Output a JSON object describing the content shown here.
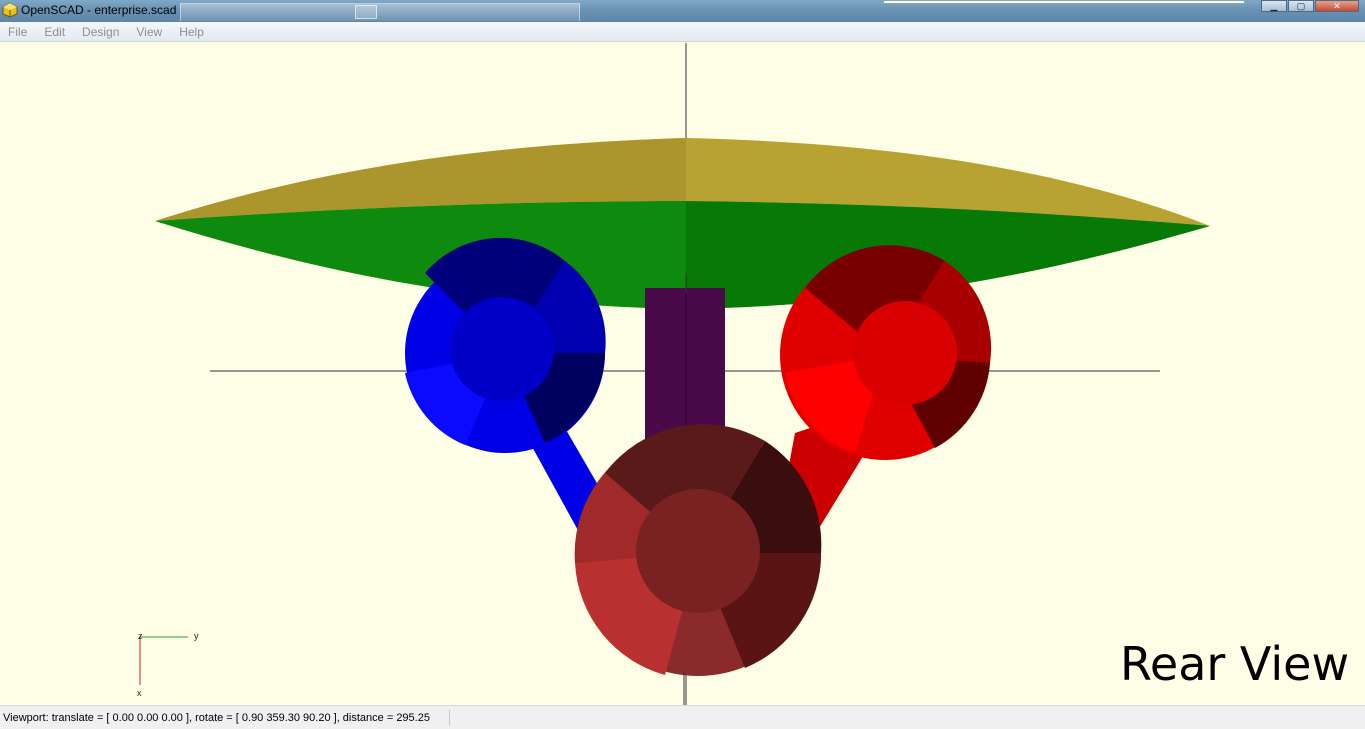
{
  "window": {
    "title": "OpenSCAD - enterprise.scad",
    "min_symbol": "▁",
    "max_symbol": "▢",
    "close_symbol": "✕"
  },
  "menu": {
    "file": "File",
    "edit": "Edit",
    "design": "Design",
    "view": "View",
    "help": "Help"
  },
  "viewport": {
    "overlay_label": "Rear View",
    "axis_z": "z",
    "axis_y": "y",
    "axis_x": "x",
    "background_color": "#fefee6",
    "saucer_top_color": "#b8a232",
    "saucer_bottom_color": "#0e8a0e",
    "left_nacelle_color": "#0000e6",
    "right_nacelle_color": "#e00000",
    "neck_color": "#4a0a4a",
    "secondary_hull_color": "#8a2a2a"
  },
  "status": {
    "text": "Viewport: translate = [ 0.00 0.00 0.00 ], rotate = [ 0.90 359.30 90.20 ], distance = 295.25"
  }
}
